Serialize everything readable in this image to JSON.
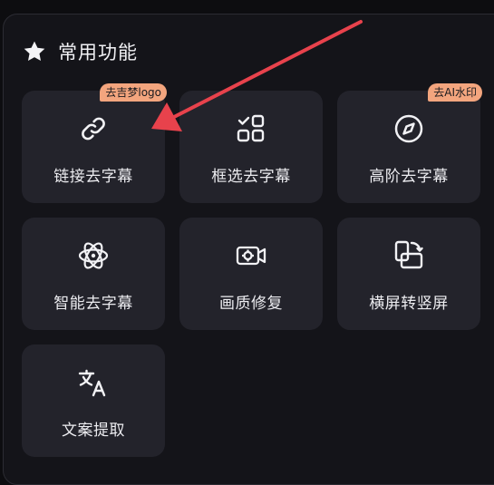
{
  "header": {
    "title": "常用功能",
    "icon": "star-icon"
  },
  "cards": [
    {
      "label": "链接去字幕",
      "icon": "link-icon",
      "badge": "去吉梦logo"
    },
    {
      "label": "框选去字幕",
      "icon": "grid-select-icon"
    },
    {
      "label": "高阶去字幕",
      "icon": "compass-icon",
      "badge": "去AI水印"
    },
    {
      "label": "智能去字幕",
      "icon": "atom-icon"
    },
    {
      "label": "画质修复",
      "icon": "camera-enhance-icon"
    },
    {
      "label": "横屏转竖屏",
      "icon": "rotate-screen-icon"
    },
    {
      "label": "文案提取",
      "icon": "translate-icon"
    }
  ],
  "colors": {
    "background": "#141419",
    "card": "#23232b",
    "badge": "#f3a57e",
    "annotation_arrow": "#e8424c"
  }
}
